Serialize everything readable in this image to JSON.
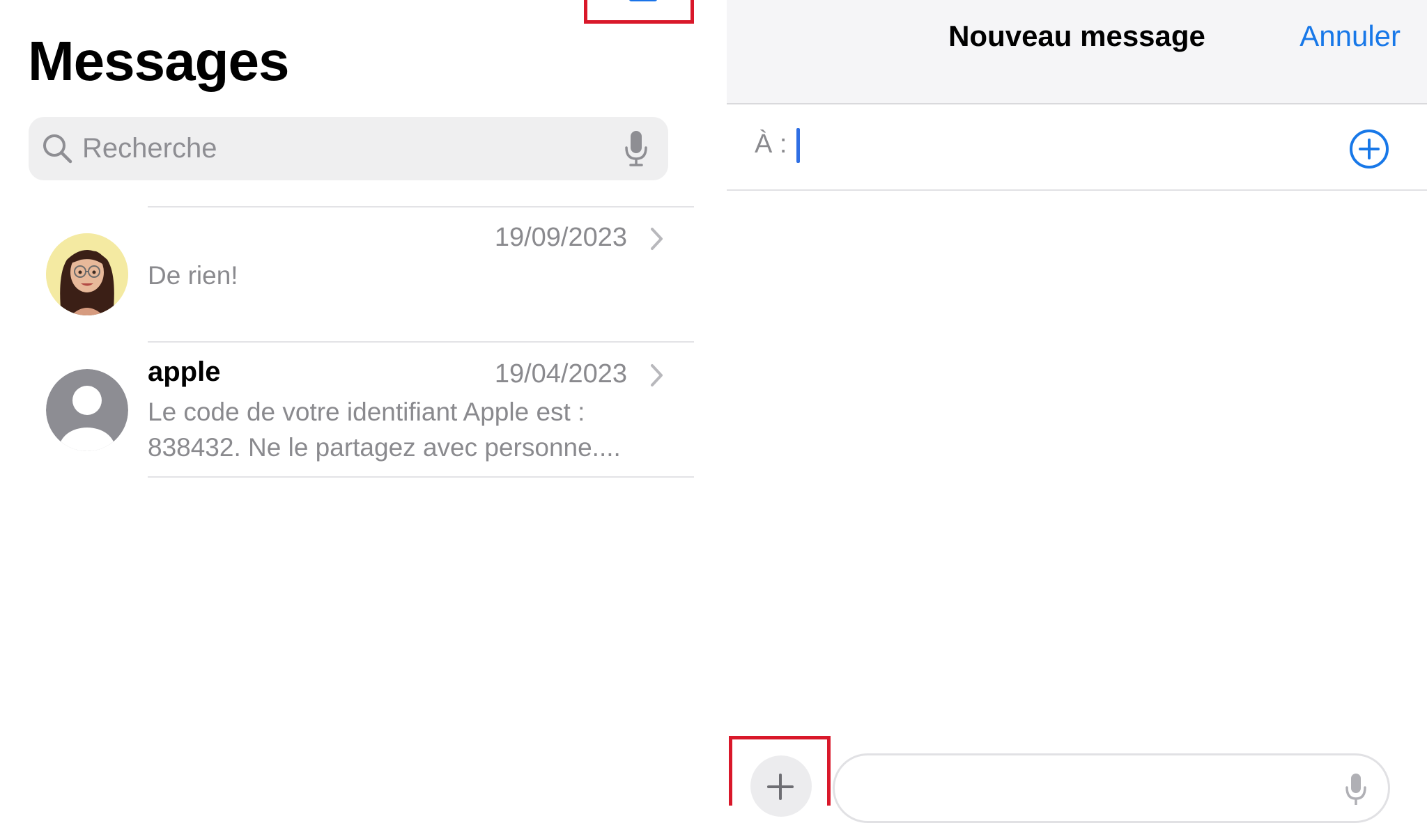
{
  "messages_list": {
    "title": "Messages",
    "search": {
      "placeholder": "Recherche",
      "icon": "search-icon",
      "mic_icon": "microphone-icon"
    },
    "compose_button_icon": "compose-icon",
    "conversations": [
      {
        "name": "",
        "date": "19/09/2023",
        "preview": "De rien!",
        "avatar": "memoji-avatar"
      },
      {
        "name": "apple",
        "date": "19/04/2023",
        "preview": "Le code de votre identifiant Apple est : 838432. Ne le partagez avec personne....",
        "avatar": "default-person-avatar"
      }
    ]
  },
  "new_message": {
    "title": "Nouveau message",
    "cancel_label": "Annuler",
    "to_label": "À :",
    "add_contact_icon": "plus-circle-icon",
    "attach_icon": "plus-icon",
    "compose_mic_icon": "microphone-icon"
  },
  "colors": {
    "accent": "#1878e8",
    "highlight": "#d9182a",
    "secondary_text": "#8a8a8e",
    "search_bg": "#efeff0"
  }
}
